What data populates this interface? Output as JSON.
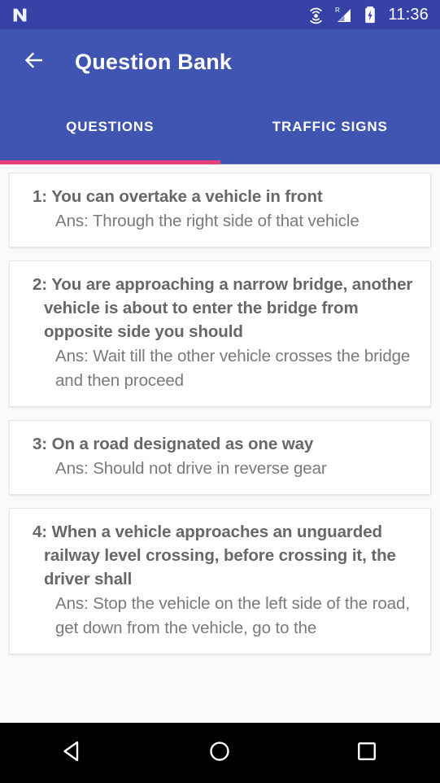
{
  "status_bar": {
    "logo_icon": "android-n-logo-icon",
    "icons": [
      {
        "name": "hotspot-icon"
      },
      {
        "name": "signal-roaming-icon",
        "badge": "R"
      },
      {
        "name": "battery-charging-icon"
      }
    ],
    "time": "11:36",
    "background": "#3642a5"
  },
  "app_bar": {
    "back_icon": "back-arrow-icon",
    "title": "Question Bank",
    "background": "#4054b2"
  },
  "tabs": {
    "items": [
      {
        "label": "QUESTIONS",
        "active": true
      },
      {
        "label": "TRAFFIC SIGNS",
        "active": false
      }
    ],
    "indicator_color": "#ec407a"
  },
  "questions": [
    {
      "question": "1: You can overtake a vehicle in front",
      "answer": "Ans: Through the right side of that vehicle"
    },
    {
      "question": "2: You are approaching a narrow bridge, another vehicle is about to enter the bridge from opposite side you should",
      "answer": "Ans: Wait till the other vehicle crosses the bridge and then proceed"
    },
    {
      "question": "3: On a road designated as one way",
      "answer": "Ans: Should not drive in reverse gear"
    },
    {
      "question": "4: When a vehicle approaches an unguarded railway level crossing, before crossing it, the driver shall",
      "answer": "Ans: Stop the vehicle on the left side of the road, get down from the vehicle, go to the"
    }
  ],
  "nav_bar": {
    "buttons": [
      {
        "name": "nav-back-icon"
      },
      {
        "name": "nav-home-icon"
      },
      {
        "name": "nav-recents-icon"
      }
    ],
    "background": "#000000"
  }
}
